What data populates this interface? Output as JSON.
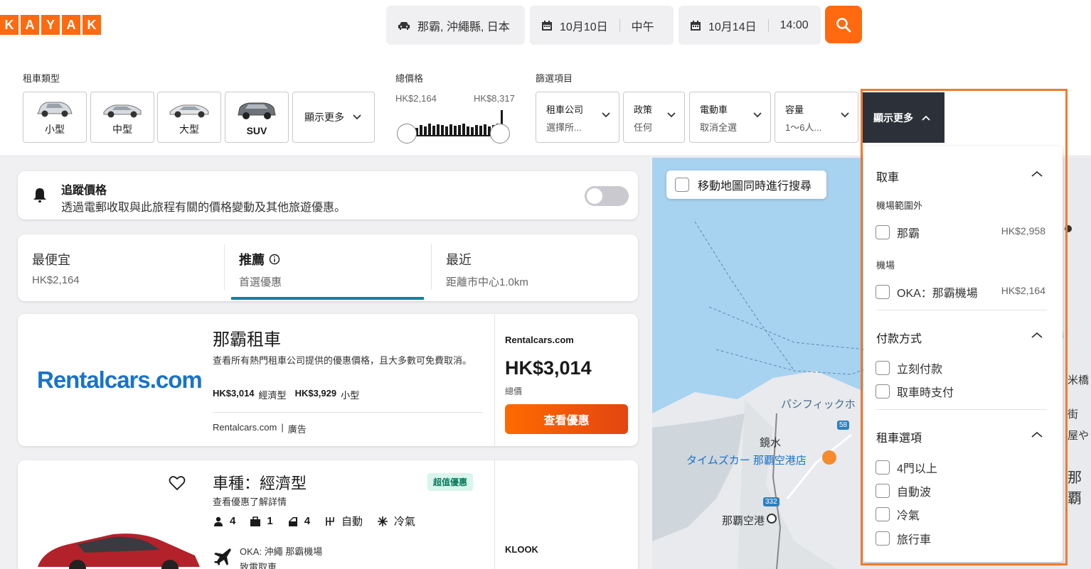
{
  "logo": [
    "K",
    "A",
    "Y",
    "A",
    "K"
  ],
  "search": {
    "location": "那霸, 沖繩縣, 日本",
    "pickup_date": "10月10日",
    "pickup_time": "中午",
    "dropoff_date": "10月14日",
    "dropoff_time": "14:00"
  },
  "filters": {
    "car_type_label": "租車類型",
    "car_types": [
      "小型",
      "中型",
      "大型",
      "SUV"
    ],
    "car_show_more": "顯示更多",
    "price_label": "總價格",
    "price_min": "HK$2,164",
    "price_max": "HK$8,317",
    "options_label": "篩選項目",
    "company": {
      "title": "租車公司",
      "value": "選擇所..."
    },
    "policy": {
      "title": "政策",
      "value": "任何"
    },
    "ev": {
      "title": "電動車",
      "value": "取消全選"
    },
    "capacity": {
      "title": "容量",
      "value": "1～6人..."
    },
    "show_more_active": "顯示更多"
  },
  "alert": {
    "title": "追蹤價格",
    "desc": "透過電郵收取與此旅程有關的價格變動及其他旅遊優惠。"
  },
  "sort_tabs": [
    {
      "title": "最便宜",
      "sub": "HK$2,164"
    },
    {
      "title": "推薦",
      "sub": "首選優惠"
    },
    {
      "title": "最近",
      "sub": "距離市中心1.0km"
    }
  ],
  "ad": {
    "brand": "Rentalcars.com",
    "title": "那霸租車",
    "desc": "查看所有熱門租車公司提供的優惠價格，且大多數可免費取消。",
    "price1": "HK$3,014",
    "type1": "經濟型",
    "price2": "HK$3,929",
    "type2": "小型",
    "footer_site": "Rentalcars.com",
    "footer_ad": "廣告",
    "provider": "Rentalcars.com",
    "price": "HK$3,014",
    "price_note": "總價",
    "cta": "查看優惠"
  },
  "result": {
    "title": "車種：經濟型",
    "badge": "超值優惠",
    "desc": "查看優惠了解詳情",
    "seats": "4",
    "bags": "1",
    "doors": "4",
    "trans": "自動",
    "ac": "冷氣",
    "location": "OKA: 沖繩 那霸機場",
    "pickup_note": "致電取車",
    "provider": "KLOOK"
  },
  "map": {
    "move_search": "移動地圖同時進行搜尋",
    "labels": [
      "パシフィックホ",
      "鏡水",
      "タイムズカー 那覇空港店",
      "那覇空港",
      "那覇",
      "米橋",
      "街",
      "屋や"
    ],
    "route_badges": [
      "58",
      "332"
    ]
  },
  "panel": {
    "pickup_heading": "取車",
    "outside_airport": "機場範圍外",
    "naha": "那霸",
    "naha_price": "HK$2,958",
    "airport": "機場",
    "oka": "OKA：那霸機場",
    "oka_price": "HK$2,164",
    "payment_heading": "付款方式",
    "pay_now": "立刻付款",
    "pay_later": "取車時支付",
    "options_heading": "租車選項",
    "opt1": "4門以上",
    "opt2": "自動波",
    "opt3": "冷氣",
    "opt4": "旅行車"
  },
  "colors": {
    "brand": "#ff690f",
    "panel_outline": "#f07a30",
    "badge_bg": "#d9f5ec",
    "badge_text": "#0a7a5a"
  }
}
